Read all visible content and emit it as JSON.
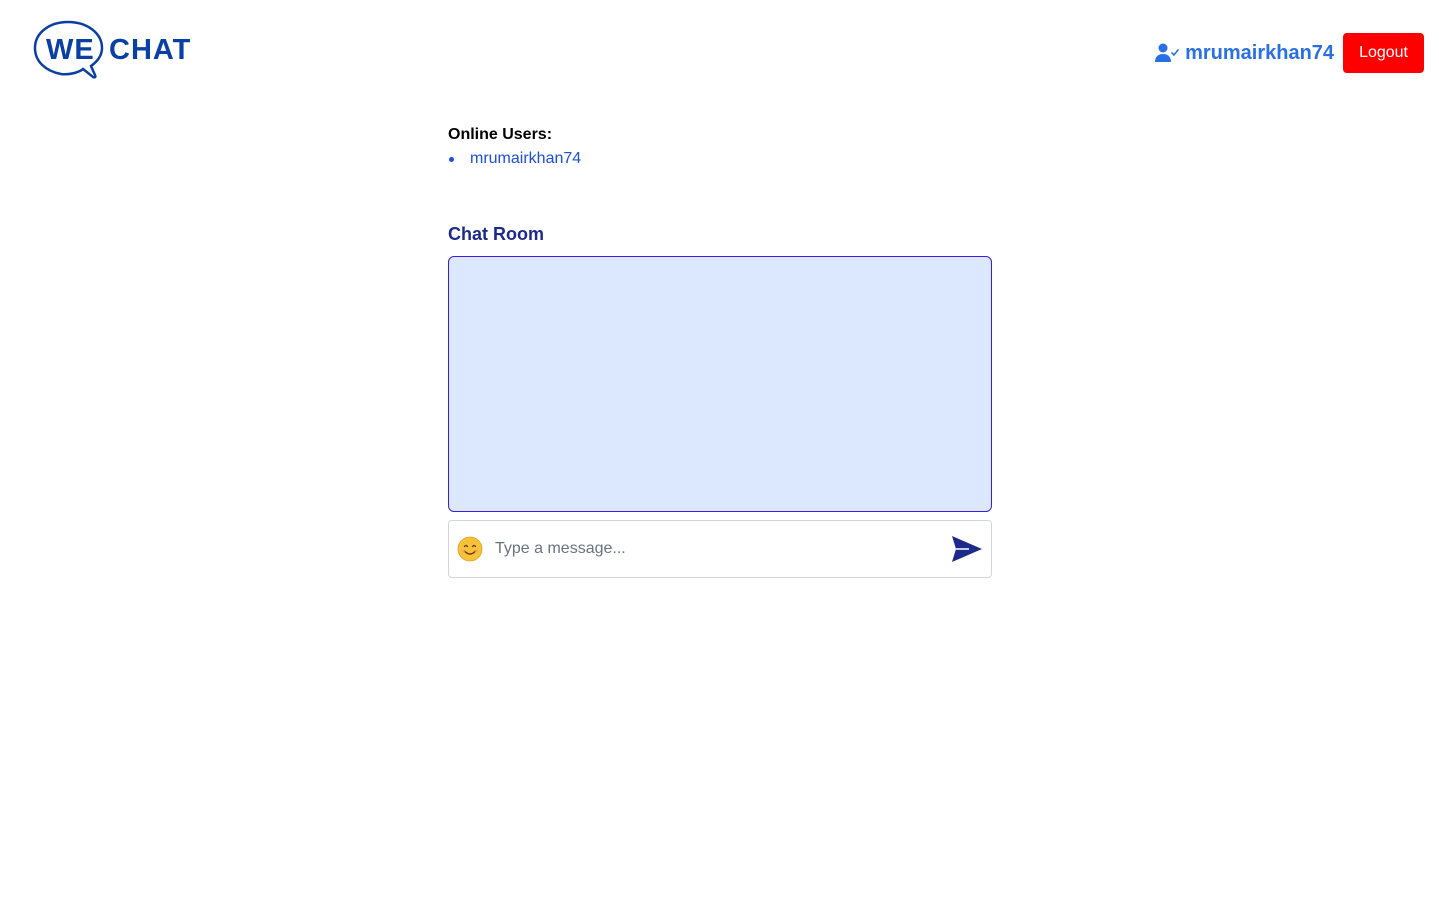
{
  "header": {
    "logo": {
      "left_text": "WE",
      "right_text": "CHAT"
    },
    "current_user": "mrumairkhan74",
    "user_icon": "user-check-icon",
    "logout_label": "Logout"
  },
  "online_users": {
    "title": "Online Users:",
    "users": [
      "mrumairkhan74"
    ]
  },
  "chat_room": {
    "title": "Chat Room",
    "messages": []
  },
  "composer": {
    "emoji_icon": "smiley-face-icon",
    "placeholder": "Type a message...",
    "value": "",
    "send_icon": "send-icon"
  },
  "colors": {
    "brand": "#0a3fa5",
    "username": "#2b6fe6",
    "logout_bg": "#ff0000",
    "chat_bg": "#dbe8fd",
    "chat_border": "#3b1ce0",
    "title": "#1e2a8a"
  }
}
